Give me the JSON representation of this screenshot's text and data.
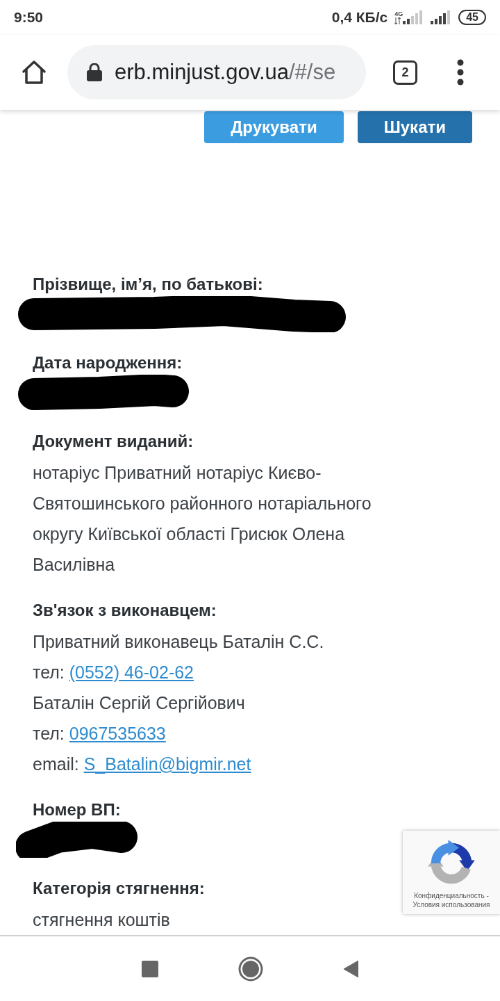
{
  "status_bar": {
    "time": "9:50",
    "speed": "0,4 КБ/с",
    "network": "4G",
    "battery": "45"
  },
  "browser": {
    "url_host": "erb.minjust.gov.ua",
    "url_path": "/#/se",
    "tab_count": "2"
  },
  "buttons": [
    {
      "label": "Друкувати",
      "color": "#3b9ce0"
    },
    {
      "label": "Шукати",
      "color": "#2471ac"
    }
  ],
  "fields": [
    {
      "label": "Прізвище, ім’я, по батькові:",
      "redacted": true
    },
    {
      "label": "Дата народження:",
      "redacted": true
    },
    {
      "label": "Документ виданий:",
      "redacted": false,
      "lines": [
        {
          "kind": "text",
          "text": "нотаріус Приватний нотаріус Києво-Святошинського районного нотаріального округу Київської області Грисюк Олена Василівна"
        }
      ]
    },
    {
      "label": "Зв'язок з виконавцем:",
      "redacted": false,
      "lines": [
        {
          "kind": "text",
          "text": "Приватний виконавець Баталін С.С."
        },
        {
          "kind": "phone",
          "prefix": "тел:",
          "link": "(0552) 46-02-62"
        },
        {
          "kind": "text",
          "text": "Баталін Сергій Сергійович"
        },
        {
          "kind": "phone",
          "prefix": "тел:",
          "link": "0967535633"
        },
        {
          "kind": "email",
          "prefix": "email:",
          "link": "S_Batalin@bigmir.net"
        }
      ]
    },
    {
      "label": "Номер ВП:",
      "redacted": true
    },
    {
      "label": "Категорія стягнення:",
      "redacted": false,
      "lines": [
        {
          "kind": "text",
          "text": "стягнення коштів"
        }
      ]
    }
  ],
  "recaptcha": {
    "privacy": "Конфиденциальность",
    "separator": "-",
    "terms": "Условия использования"
  }
}
